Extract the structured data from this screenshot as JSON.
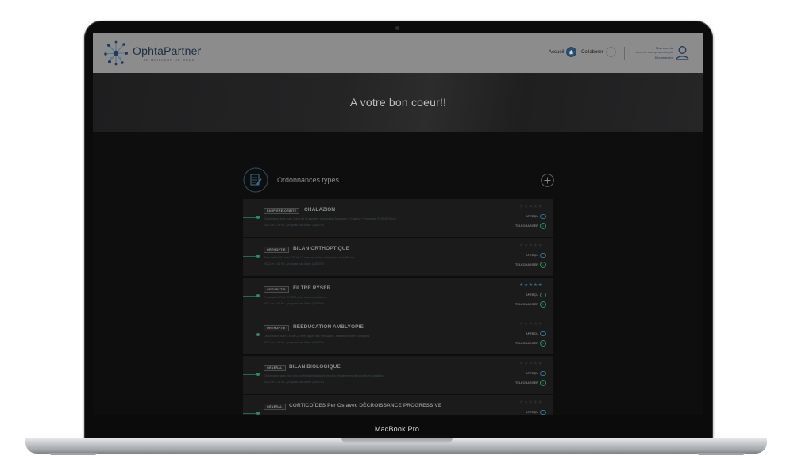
{
  "device": {
    "model": "MacBook Pro"
  },
  "header": {
    "brand": "OphtaPartner",
    "tagline": "LE MEILLEUR DE NOUS",
    "nav": {
      "home": "Accueil",
      "collaborate": "Collaborer"
    },
    "account": {
      "title": "Mon compte",
      "subtitle": "connecte user.ophtalmologiste",
      "logout": "Déconnexion"
    }
  },
  "hero": {
    "title": "A votre bon coeur!!"
  },
  "section": {
    "title": "Ordonnances types"
  },
  "cards": [
    {
      "tag": "PAUPIÈRE-ORBITE",
      "title": "CHALAZION",
      "desc": "Ordonnance type avec Soins de la paupière (application Massage + Chaleur + Pommade STERDEX ect)",
      "meta": "2021 de 4.28 Ko – proposé par Julien QUINTIN",
      "apercu": "APERÇU",
      "download": "TÉLÉCHARGER",
      "stars": "★★★★★",
      "rating_active": false
    },
    {
      "tag": "ORTHOPTIE",
      "title": "BILAN ORTHOPTIQUE",
      "desc": "Prescription AO avec CR de 12 avec appel des rééduques dans (Basic)",
      "meta": "2022 de 4.35 Ko – proposé par Julien QUINTIN",
      "apercu": "APERÇU",
      "download": "TÉLÉCHARGER",
      "stars": "★★★★★",
      "rating_active": false
    },
    {
      "tag": "ORTHOPTIE",
      "title": "FILTRE RYSER",
      "desc": "Prescription Filtre RYSER avec recommandations",
      "meta": "2021 de 4.06 Ko – proposé par Julien QUINTIN",
      "apercu": "APERÇU",
      "download": "TÉLÉCHARGER",
      "stars": "★★★★★",
      "rating_active": true
    },
    {
      "tag": "ORTHOPTIE",
      "title": "RÉÉDUCATION AMBLYOPIE",
      "desc": "Ordonnance avec CR de CS avec appel des rééduques, soldats verbe et consignes",
      "meta": "2022 de 4.39 Ko – proposé par Julien QUINTIN",
      "apercu": "APERÇU",
      "download": "TÉLÉCHARGER",
      "stars": "★★★★★",
      "rating_active": false
    },
    {
      "tag": "GÉNÉRAL",
      "title": "BILAN BIOLOGIQUE",
      "desc": "Ordonnance avec liste des examens biologiques les plus fréquemment demandés en ophtalmo",
      "meta": "2022 de 4.19 Ko – proposé par Julien QUINTIN",
      "apercu": "APERÇU",
      "download": "TÉLÉCHARGER",
      "stars": "★★★★★",
      "rating_active": false
    },
    {
      "tag": "GÉNÉRAL",
      "title": "CORTICOÏDES Per Os avec DÉCROISSANCE PROGRESSIVE",
      "desc": "",
      "meta": "",
      "apercu": "APERÇU",
      "download": "",
      "stars": "★★★★★",
      "rating_active": false
    }
  ],
  "colors": {
    "accent_blue": "#3c6f8e",
    "accent_green": "#2f8a5f",
    "header_bg": "#8c8c8c",
    "screen_bg": "#0e0e0f"
  },
  "icons": {
    "logo": "network-logo-icon",
    "home": "home-icon",
    "add": "plus-circle-icon",
    "user": "user-icon",
    "doc": "document-edit-icon",
    "preview": "eye-icon",
    "download": "download-icon"
  }
}
